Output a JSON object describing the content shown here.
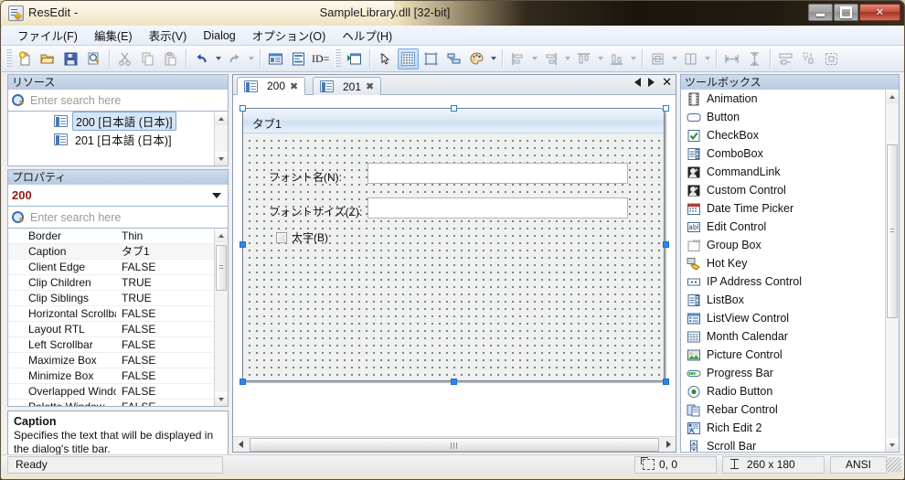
{
  "window": {
    "app_name": "ResEdit -",
    "document_title": "SampleLibrary.dll [32-bit]",
    "app_icon": "resedit-icon",
    "buttons": {
      "minimize": "minimize-button",
      "maximize": "maximize-button",
      "close": "✕"
    }
  },
  "menubar": {
    "items": [
      {
        "label": "ファイル(F)"
      },
      {
        "label": "編集(E)"
      },
      {
        "label": "表示(V)"
      },
      {
        "label": "Dialog"
      },
      {
        "label": "オプション(O)"
      },
      {
        "label": "ヘルプ(H)"
      }
    ]
  },
  "toolbar": {
    "id_label": "ID=",
    "buttons": [
      {
        "name": "new-file-icon"
      },
      {
        "name": "open-folder-icon"
      },
      {
        "name": "save-icon"
      },
      {
        "name": "print-preview-icon"
      },
      {
        "name": "cut-icon"
      },
      {
        "name": "copy-icon"
      },
      {
        "name": "paste-icon"
      },
      {
        "name": "undo-icon"
      },
      {
        "name": "redo-icon"
      },
      {
        "name": "dialog-editor-icon"
      },
      {
        "name": "menu-editor-icon"
      },
      {
        "name": "run-test-dialog-icon"
      },
      {
        "name": "select-pointer-icon"
      },
      {
        "name": "toggle-grid-icon"
      },
      {
        "name": "guides-icon"
      },
      {
        "name": "tab-order-icon"
      },
      {
        "name": "color-palette-icon"
      },
      {
        "name": "align-left-icon"
      },
      {
        "name": "align-right-icon"
      },
      {
        "name": "align-top-icon"
      },
      {
        "name": "align-bottom-icon"
      },
      {
        "name": "center-vertical-icon"
      },
      {
        "name": "center-horizontal-icon"
      },
      {
        "name": "same-width-icon"
      },
      {
        "name": "same-height-icon"
      },
      {
        "name": "space-horizontal-icon"
      },
      {
        "name": "space-vertical-icon"
      },
      {
        "name": "size-to-content-icon"
      }
    ]
  },
  "resources": {
    "header": "リソース",
    "search_placeholder": "Enter search here",
    "items": [
      {
        "label": "200 [日本語 (日本)]",
        "selected": true
      },
      {
        "label": "201 [日本語 (日本)]",
        "selected": false
      }
    ]
  },
  "properties": {
    "header": "プロパティ",
    "selected_object": "200",
    "search_placeholder": "Enter search here",
    "rows": [
      {
        "name": "Border",
        "value": "Thin"
      },
      {
        "name": "Caption",
        "value": "タブ1"
      },
      {
        "name": "Client Edge",
        "value": "FALSE"
      },
      {
        "name": "Clip Children",
        "value": "TRUE"
      },
      {
        "name": "Clip Siblings",
        "value": "TRUE"
      },
      {
        "name": "Horizontal Scrollbar",
        "value": "FALSE"
      },
      {
        "name": "Layout RTL",
        "value": "FALSE"
      },
      {
        "name": "Left Scrollbar",
        "value": "FALSE"
      },
      {
        "name": "Maximize Box",
        "value": "FALSE"
      },
      {
        "name": "Minimize Box",
        "value": "FALSE"
      },
      {
        "name": "Overlapped Window",
        "value": "FALSE"
      },
      {
        "name": "Palette Window",
        "value": "FALSE"
      }
    ]
  },
  "description": {
    "title": "Caption",
    "text": "Specifies the text that will be displayed in the dialog's title bar."
  },
  "editor": {
    "tabs": [
      {
        "label": "200",
        "active": true,
        "close": "✖"
      },
      {
        "label": "201",
        "active": false,
        "close": "✖"
      }
    ],
    "nav": {
      "prev": "prev-tab",
      "next": "next-tab",
      "close": "✕"
    },
    "dialog": {
      "caption": "タブ1",
      "controls": [
        {
          "type": "label",
          "text": "フォント名(N):"
        },
        {
          "type": "edit",
          "text": ""
        },
        {
          "type": "label",
          "text": "フォントサイズ(Z):"
        },
        {
          "type": "edit",
          "text": ""
        },
        {
          "type": "checkbox",
          "text": "太字(B)",
          "checked": false
        }
      ]
    }
  },
  "toolbox": {
    "header": "ツールボックス",
    "items": [
      {
        "label": "Animation",
        "icon": "animation-icon"
      },
      {
        "label": "Button",
        "icon": "button-icon"
      },
      {
        "label": "CheckBox",
        "icon": "checkbox-icon"
      },
      {
        "label": "ComboBox",
        "icon": "combobox-icon"
      },
      {
        "label": "CommandLink",
        "icon": "commandlink-icon"
      },
      {
        "label": "Custom Control",
        "icon": "custom-control-icon"
      },
      {
        "label": "Date Time Picker",
        "icon": "datetimepicker-icon"
      },
      {
        "label": "Edit Control",
        "icon": "edit-control-icon"
      },
      {
        "label": "Group Box",
        "icon": "groupbox-icon"
      },
      {
        "label": "Hot Key",
        "icon": "hotkey-icon"
      },
      {
        "label": "IP Address Control",
        "icon": "ip-address-icon"
      },
      {
        "label": "ListBox",
        "icon": "listbox-icon"
      },
      {
        "label": "ListView Control",
        "icon": "listview-icon"
      },
      {
        "label": "Month Calendar",
        "icon": "month-calendar-icon"
      },
      {
        "label": "Picture Control",
        "icon": "picture-control-icon"
      },
      {
        "label": "Progress Bar",
        "icon": "progressbar-icon"
      },
      {
        "label": "Radio Button",
        "icon": "radiobutton-icon"
      },
      {
        "label": "Rebar Control",
        "icon": "rebar-icon"
      },
      {
        "label": "Rich Edit 2",
        "icon": "richedit-icon"
      },
      {
        "label": "Scroll Bar",
        "icon": "scrollbar-icon"
      }
    ]
  },
  "statusbar": {
    "message": "Ready",
    "position": "0, 0",
    "size": "260 x 180",
    "encoding": "ANSI"
  },
  "colors": {
    "accent": "#2f86e8",
    "title_frame": "#f7eed9",
    "panel_header": "#cfdcec",
    "property_value": "#8c1a1a"
  }
}
